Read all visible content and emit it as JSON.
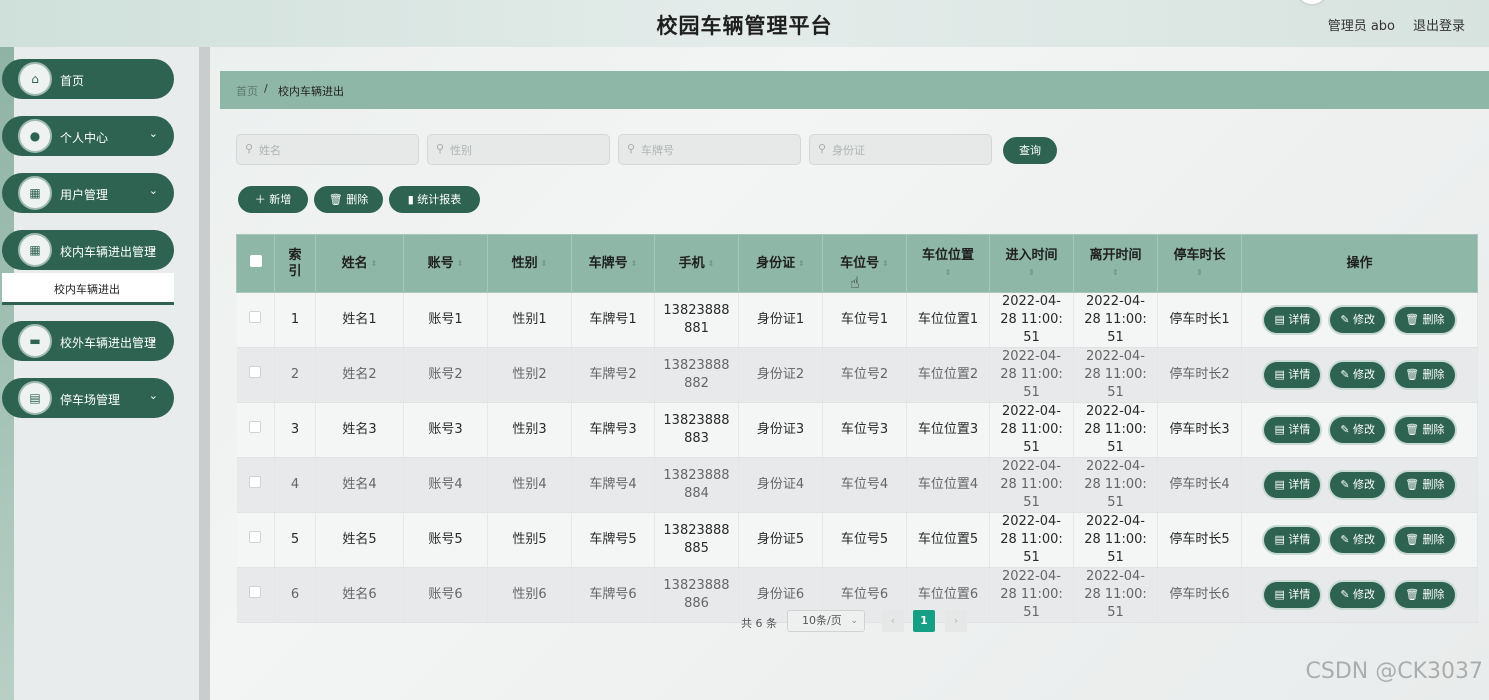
{
  "header": {
    "title": "校园车辆管理平台",
    "admin_label": "管理员 abo",
    "logout_label": "退出登录"
  },
  "sidebar": {
    "items": [
      {
        "label": "首页",
        "icon": "home-icon",
        "glyph": "⌂",
        "has_chevron": false
      },
      {
        "label": "个人中心",
        "icon": "user-icon",
        "glyph": "●",
        "has_chevron": true
      },
      {
        "label": "用户管理",
        "icon": "grid-icon",
        "glyph": "▦",
        "has_chevron": true
      },
      {
        "label": "校内车辆进出管理",
        "icon": "grid-icon",
        "glyph": "▦",
        "has_chevron": true
      },
      {
        "label": "校外车辆进出管理",
        "icon": "briefcase-icon",
        "glyph": "▬",
        "has_chevron": true
      },
      {
        "label": "停车场管理",
        "icon": "clipboard-icon",
        "glyph": "▤",
        "has_chevron": true
      }
    ],
    "submenu_label": "校内车辆进出"
  },
  "breadcrumb": {
    "home": "首页",
    "separator": "/",
    "current": "校内车辆进出"
  },
  "search": {
    "name_placeholder": "姓名",
    "gender_placeholder": "性别",
    "plate_placeholder": "车牌号",
    "id_placeholder": "身份证",
    "query_label": "查询"
  },
  "toolbar": {
    "add_label": "＋ 新增",
    "delete_label": "🗑 删除",
    "report_label": "▮ 统计报表"
  },
  "table": {
    "headers": [
      "索引",
      "姓名",
      "账号",
      "性别",
      "车牌号",
      "手机",
      "身份证",
      "车位号",
      "车位位置",
      "进入时间",
      "离开时间",
      "停车时长",
      "操作"
    ],
    "rows": [
      [
        "1",
        "姓名1",
        "账号1",
        "性别1",
        "车牌号1",
        "13823888881",
        "身份证1",
        "车位号1",
        "车位位置1",
        "2022-04-28 11:00:51",
        "2022-04-28 11:00:51",
        "停车时长1"
      ],
      [
        "2",
        "姓名2",
        "账号2",
        "性别2",
        "车牌号2",
        "13823888882",
        "身份证2",
        "车位号2",
        "车位位置2",
        "2022-04-28 11:00:51",
        "2022-04-28 11:00:51",
        "停车时长2"
      ],
      [
        "3",
        "姓名3",
        "账号3",
        "性别3",
        "车牌号3",
        "13823888883",
        "身份证3",
        "车位号3",
        "车位位置3",
        "2022-04-28 11:00:51",
        "2022-04-28 11:00:51",
        "停车时长3"
      ],
      [
        "4",
        "姓名4",
        "账号4",
        "性别4",
        "车牌号4",
        "13823888884",
        "身份证4",
        "车位号4",
        "车位位置4",
        "2022-04-28 11:00:51",
        "2022-04-28 11:00:51",
        "停车时长4"
      ],
      [
        "5",
        "姓名5",
        "账号5",
        "性别5",
        "车牌号5",
        "13823888885",
        "身份证5",
        "车位号5",
        "车位位置5",
        "2022-04-28 11:00:51",
        "2022-04-28 11:00:51",
        "停车时长5"
      ],
      [
        "6",
        "姓名6",
        "账号6",
        "性别6",
        "车牌号6",
        "13823888886",
        "身份证6",
        "车位号6",
        "车位位置6",
        "2022-04-28 11:00:51",
        "2022-04-28 11:00:51",
        "停车时长6"
      ]
    ],
    "action_labels": [
      "▤ 详情",
      "✎ 修改",
      "🗑 删除"
    ]
  },
  "pagination": {
    "total": "共 6 条",
    "page_size": "10条/页",
    "current_page": "1",
    "prev": "‹",
    "next": "›"
  },
  "watermark": "CSDN @CK3037",
  "colors": {
    "primary": "#2d6350",
    "header_accent": "#8fb7a8",
    "active_page": "#15a085"
  }
}
